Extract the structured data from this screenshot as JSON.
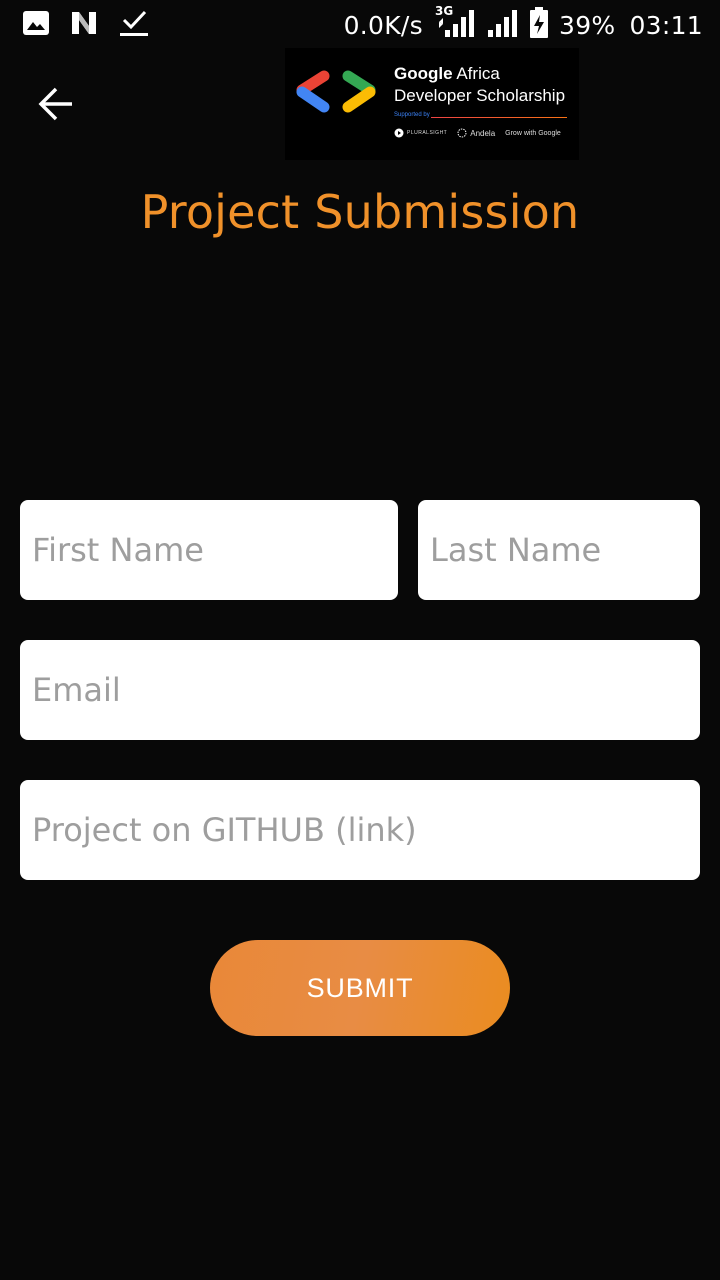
{
  "status_bar": {
    "notification_icons": [
      "gallery-icon",
      "n-app-icon",
      "download-complete-icon"
    ],
    "net_speed": "0.0K/s",
    "network_type": "3G",
    "battery_percent": "39%",
    "time": "03:11"
  },
  "header": {
    "back_icon": "arrow-left-icon",
    "banner": {
      "title_strong": "Google",
      "title_rest": " Africa",
      "subtitle": "Developer Scholarship",
      "supported_by": "Supported by",
      "partners": [
        "PLURALSIGHT",
        "Andela",
        "Grow with Google"
      ]
    }
  },
  "page_title": "Project Submission",
  "form": {
    "first_name_placeholder": "First Name",
    "last_name_placeholder": "Last Name",
    "email_placeholder": "Email",
    "github_placeholder": "Project on GITHUB (link)",
    "submit_label": "SUBMIT"
  },
  "colors": {
    "background": "#080808",
    "accent": "#f0912a",
    "field_background": "#ffffff",
    "placeholder": "#9e9e9e"
  }
}
